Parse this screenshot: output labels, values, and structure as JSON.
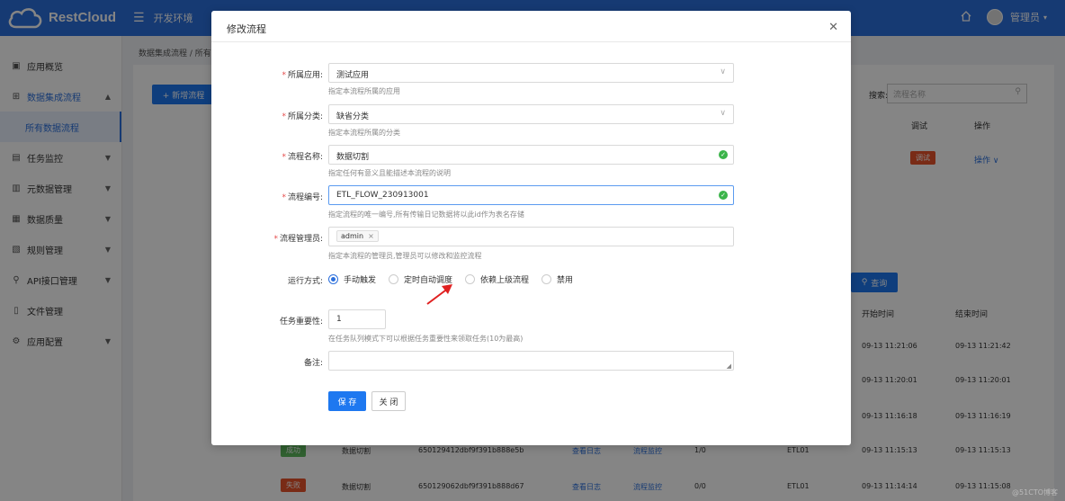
{
  "app": {
    "logo_text": "RestCloud",
    "env_label": "开发环境",
    "user_label": "管理员"
  },
  "sidebar": {
    "items": [
      {
        "label": "应用概览",
        "icon": "dashboard-icon"
      },
      {
        "label": "数据集成流程",
        "icon": "integration-icon"
      },
      {
        "label": "所有数据流程",
        "icon": ""
      },
      {
        "label": "任务监控",
        "icon": "monitor-icon"
      },
      {
        "label": "元数据管理",
        "icon": "metadata-icon"
      },
      {
        "label": "数据质量",
        "icon": "quality-icon"
      },
      {
        "label": "规则管理",
        "icon": "rule-icon"
      },
      {
        "label": "API接口管理",
        "icon": "api-icon"
      },
      {
        "label": "文件管理",
        "icon": "file-icon"
      },
      {
        "label": "应用配置",
        "icon": "settings-icon"
      }
    ]
  },
  "background": {
    "breadcrumb": "数据集成流程 / 所有",
    "new_flow_button": "+ 新增流程",
    "search_label": "搜索:",
    "search_placeholder": "流程名称",
    "query_button": "查询",
    "col_debug": "调试",
    "col_action": "操作",
    "debug_button": "调试",
    "action_link": "操作 ∨",
    "col_start": "开始时间",
    "col_end": "结束时间",
    "times": [
      {
        "start": "09-13 11:21:06",
        "end": "09-13 11:21:42"
      },
      {
        "start": "09-13 11:20:01",
        "end": "09-13 11:20:01"
      },
      {
        "start": "09-13 11:16:18",
        "end": "09-13 11:16:19"
      },
      {
        "start": "09-13 11:15:13",
        "end": "09-13 11:15:13"
      },
      {
        "start": "09-13 11:14:14",
        "end": "09-13 11:15:08"
      }
    ],
    "rows": [
      {
        "status": "成功",
        "name": "数据切割",
        "id": "650129412dbf9f391b888e5b",
        "log": "查看日志",
        "monitor": "流程监控",
        "count": "1/0",
        "env": "ETL01"
      },
      {
        "status": "失败",
        "name": "数据切割",
        "id": "650129062dbf9f391b888d67",
        "log": "查看日志",
        "monitor": "流程监控",
        "count": "0/0",
        "env": "ETL01"
      }
    ],
    "status_colors": {
      "success": "#5cb85c",
      "fail": "#e8532b"
    }
  },
  "modal": {
    "title": "修改流程",
    "fields": {
      "app": {
        "label": "所属应用:",
        "value": "测试应用",
        "hint": "指定本流程所属的应用"
      },
      "category": {
        "label": "所属分类:",
        "value": "缺省分类",
        "hint": "指定本流程所属的分类"
      },
      "name": {
        "label": "流程名称:",
        "value": "数据切割",
        "hint": "指定任何有意义且能描述本流程的说明"
      },
      "code": {
        "label": "流程编号:",
        "value": "ETL_FLOW_230913001",
        "hint": "指定流程的唯一编号,所有传输日记数据将以此id作为表名存储"
      },
      "manager": {
        "label": "流程管理员:",
        "chip": "admin",
        "hint": "指定本流程的管理员,管理员可以修改和监控流程"
      },
      "run_mode": {
        "label": "运行方式:",
        "options": [
          "手动触发",
          "定时自动调度",
          "依赖上级流程",
          "禁用"
        ],
        "selected": "手动触发"
      },
      "priority": {
        "label": "任务重要性:",
        "value": "1",
        "hint": "在任务队列模式下可以根据任务重要性来领取任务(10为最高)"
      },
      "remark": {
        "label": "备注:",
        "value": ""
      }
    },
    "save_label": "保 存",
    "close_label": "关 闭"
  },
  "watermark": "@51CTO博客"
}
